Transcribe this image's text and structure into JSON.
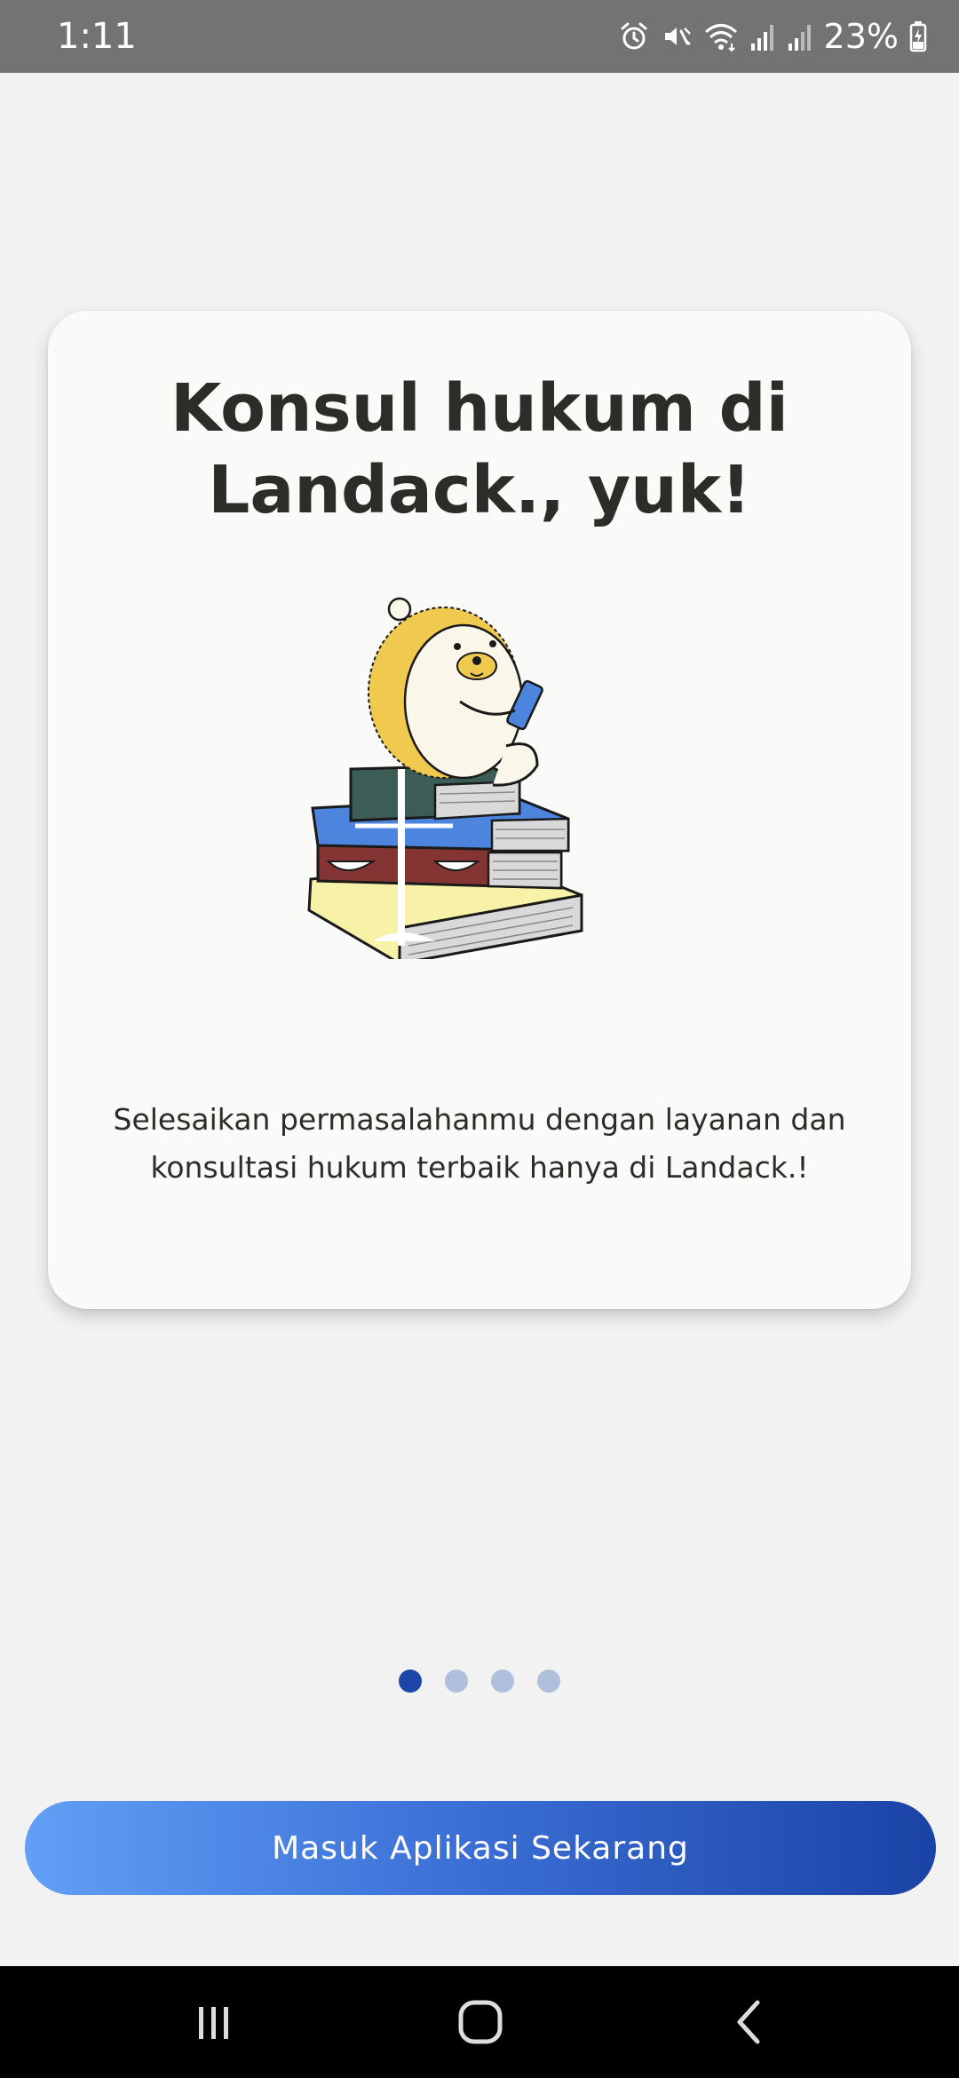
{
  "status_bar": {
    "time": "1:11",
    "battery_percent": "23%",
    "icons": [
      "alarm-icon",
      "mute-vibrate-icon",
      "wifi-icon",
      "signal-icon",
      "signal-icon",
      "battery-charging-icon"
    ]
  },
  "onboarding": {
    "title": "Konsul hukum di Landack., yuk!",
    "description": "Selesaikan permasalahanmu dengan layanan dan konsultasi hukum terbaik hanya di Landack.!",
    "illustration": "hedgehog-on-law-books-illustration",
    "pages_total": 4,
    "current_page": 1
  },
  "cta": {
    "label": "Masuk Aplikasi Sekarang"
  },
  "navigation_bar": {
    "icons": [
      "recent-apps-icon",
      "home-icon",
      "back-icon"
    ]
  },
  "colors": {
    "status_bar": "#737373",
    "background": "#f2f2f3",
    "card": "#fafaf8",
    "title_text": "#2d2c28",
    "dot_active": "#1c47a8",
    "dot_inactive": "#b0c0dc",
    "button_gradient_start": "#61a0f6",
    "button_gradient_end": "#1b43a6"
  }
}
